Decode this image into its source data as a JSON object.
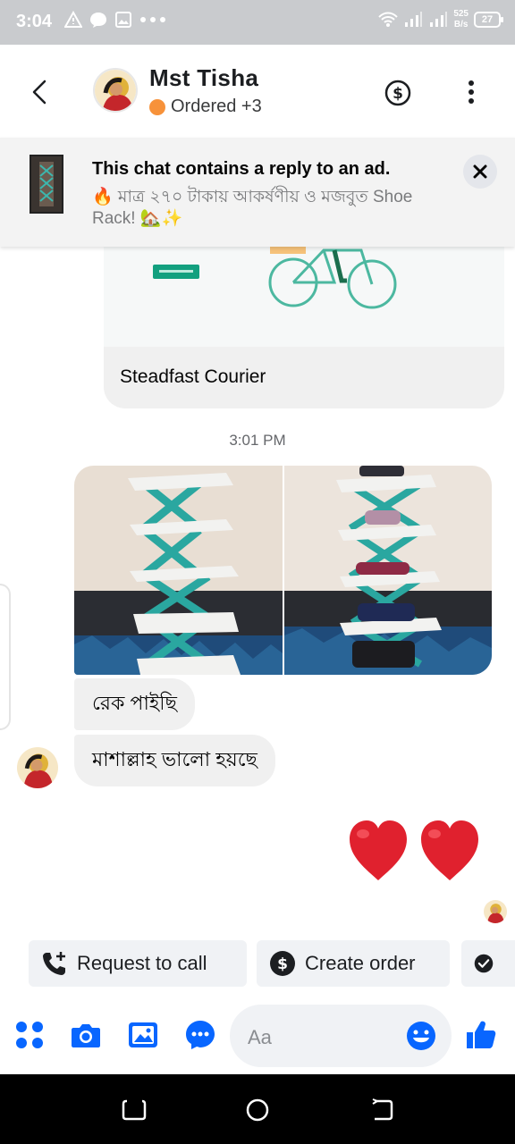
{
  "status_bar": {
    "time": "3:04",
    "net_speed_value": "525",
    "net_speed_unit": "B/s",
    "battery": "27"
  },
  "header": {
    "contact_name": "Mst Tisha",
    "contact_status": "Ordered +3",
    "status_color": "#f7923a"
  },
  "ad_banner": {
    "title": "This chat contains a reply to an ad.",
    "description": "🔥 মাত্র ২৭০ টাকায় আকর্ষণীয় ও মজবুত  Shoe Rack! 🏡✨"
  },
  "link_card": {
    "title": "Steadfast Courier"
  },
  "conversation": {
    "timestamp": "3:01 PM",
    "messages": [
      {
        "text": "রেক পাইছি"
      },
      {
        "text": "মাশাল্লাহ  ভালো হয়ছে"
      }
    ],
    "reaction": "❤️❤️"
  },
  "quick_actions": [
    {
      "label": "Request to call",
      "icon": "phone-plus-icon"
    },
    {
      "label": "Create order",
      "icon": "dollar-icon"
    },
    {
      "label": "",
      "icon": "check-circle-icon"
    }
  ],
  "composer": {
    "placeholder": "Aa"
  },
  "colors": {
    "accent": "#0866ff",
    "bubble": "#f0f0f0",
    "heart": "#e0212e"
  }
}
